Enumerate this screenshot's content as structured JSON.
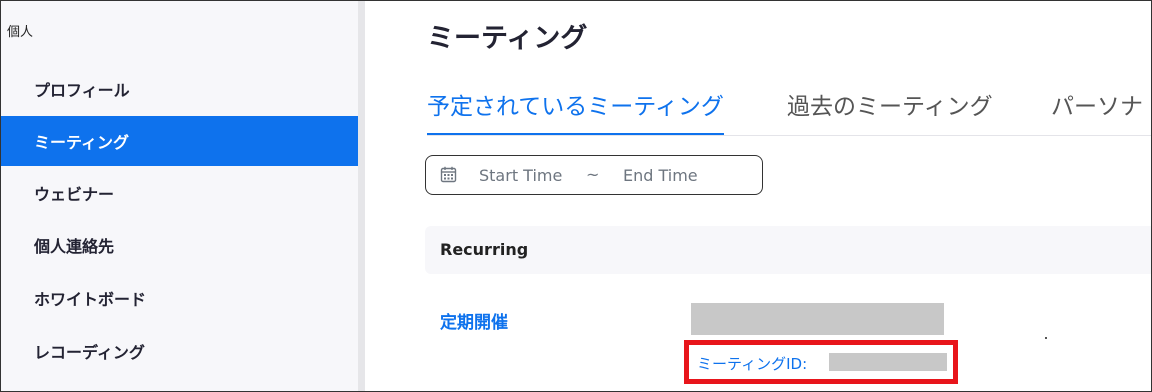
{
  "sidebar": {
    "section_label": "個人",
    "items": [
      {
        "label": "プロフィール",
        "active": false
      },
      {
        "label": "ミーティング",
        "active": true
      },
      {
        "label": "ウェビナー",
        "active": false
      },
      {
        "label": "個人連絡先",
        "active": false
      },
      {
        "label": "ホワイトボード",
        "active": false
      },
      {
        "label": "レコーディング",
        "active": false
      }
    ]
  },
  "main": {
    "title": "ミーティング",
    "tabs": [
      {
        "label": "予定されているミーティング",
        "active": true
      },
      {
        "label": "過去のミーティング",
        "active": false
      },
      {
        "label": "パーソナ",
        "active": false
      }
    ],
    "date_range": {
      "icon": "calendar-icon",
      "start_placeholder": "Start Time",
      "separator": "~",
      "end_placeholder": "End Time"
    },
    "section": {
      "label": "Recurring"
    },
    "meeting": {
      "topic": "定期開催",
      "id_label": "ミーティングID:"
    }
  },
  "colors": {
    "accent": "#0e72ed",
    "highlight_box": "#e8151b",
    "redaction": "#c8c8c8"
  }
}
